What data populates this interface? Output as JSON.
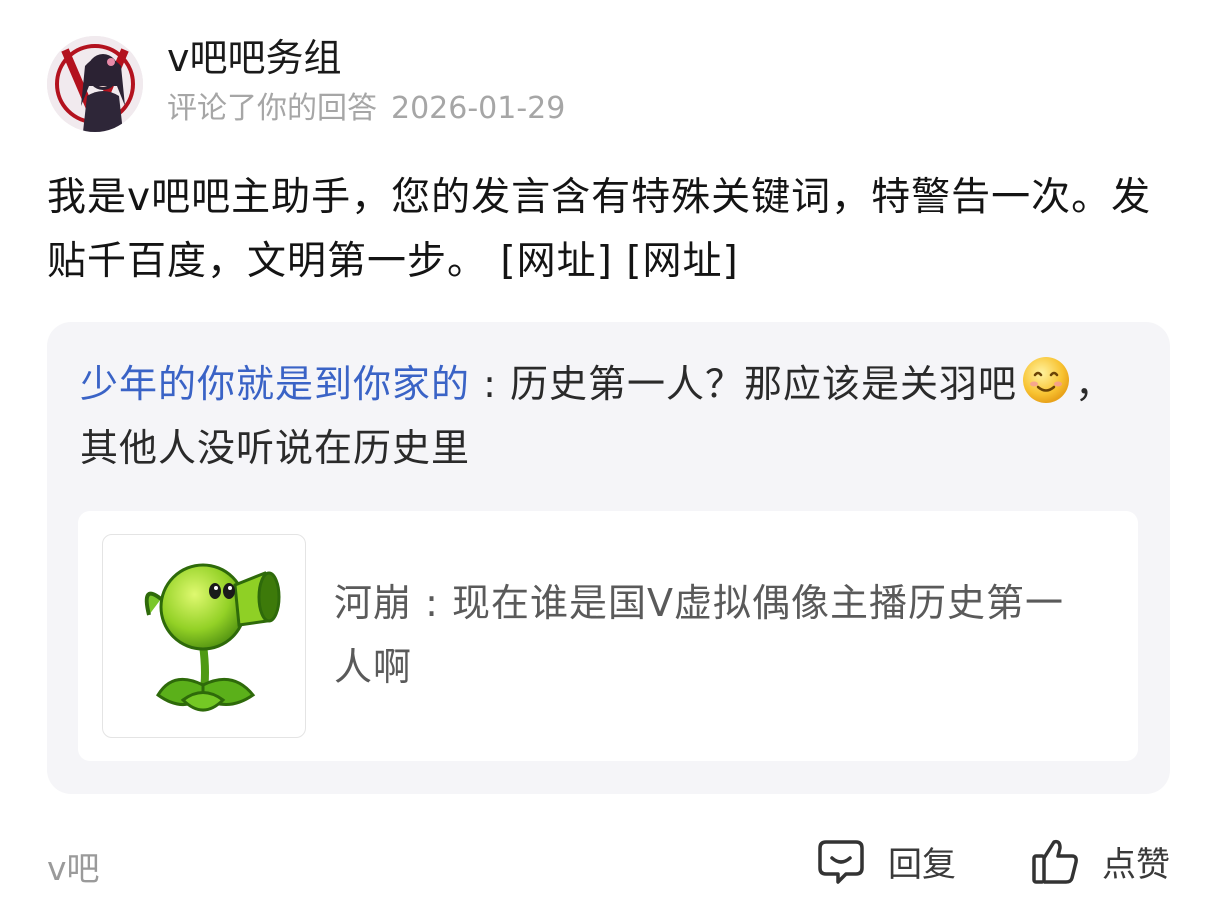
{
  "post": {
    "username": "v吧吧务组",
    "action": "评论了你的回答",
    "date": "2026-01-29",
    "content": "我是v吧吧主助手，您的发言含有特殊关键词，特警告一次。发贴千百度，文明第一步。 [网址] [网址]"
  },
  "quote": {
    "author": "少年的你就是到你家的",
    "separator": ":",
    "text_before_emoji": "历史第一人？那应该是关羽吧",
    "emoji_icon": "smile-emoji-icon",
    "text_after_emoji": "，其他人没听说在历史里"
  },
  "original": {
    "author": "河崩",
    "separator": ":",
    "text": "现在谁是国V虚拟偶像主播历史第一人啊",
    "thumbnail_icon": "peashooter-icon"
  },
  "footer": {
    "forum": "v吧",
    "reply_label": "回复",
    "like_label": "点赞"
  },
  "colors": {
    "author_link": "#3a63c6",
    "quote_bg": "#f5f5f8",
    "muted_text": "#a6a6a6"
  }
}
